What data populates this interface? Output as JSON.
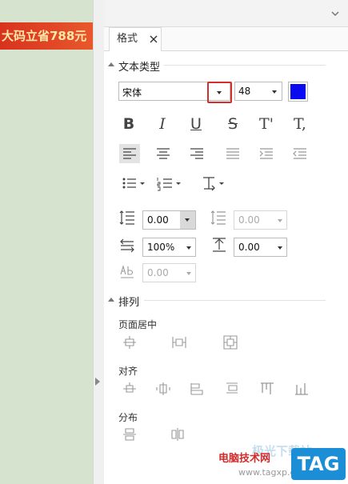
{
  "banner": {
    "text": "大码立省788元"
  },
  "tab": {
    "label": "格式"
  },
  "text_type": {
    "title": "文本类型",
    "font_name": "宋体",
    "font_size": "48",
    "font_color": "#0a0af0",
    "formatting": {
      "bold": "B",
      "italic": "I",
      "underline": "U",
      "strike": "S",
      "superscript": "T'",
      "subscript": "T,"
    },
    "line_spacing": "0.00",
    "paragraph_spacing": "0.00",
    "char_scale": "100%",
    "char_spacing": "0.00",
    "auto_spacing": "0.00"
  },
  "arrange": {
    "title": "排列",
    "page_center_label": "页面居中",
    "align_label": "对齐",
    "distribute_label": "分布"
  },
  "watermark": {
    "text": "电脑技术网",
    "url": "www.tagxp.com",
    "faint": "极光下载站",
    "logo": "TAG"
  },
  "colors": {
    "highlight": "#d3302b",
    "banner": "#d8321e",
    "canvas": "#d6e3cf"
  }
}
